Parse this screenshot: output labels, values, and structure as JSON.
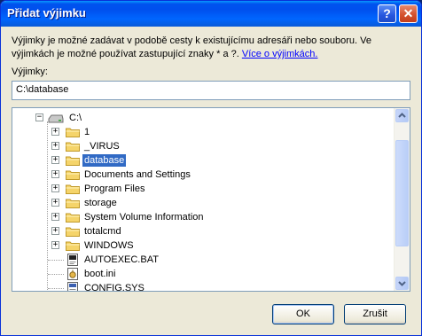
{
  "dialog": {
    "title": "Přidat výjimku",
    "help_label": "?",
    "close_label": "✕",
    "description": "Výjimky je možné zadávat v podobě cesty k existujícímu adresáři nebo souboru. Ve výjimkách je možné používat zastupující znaky * a ?.",
    "link_text": "Více o výjimkách.",
    "field_label": "Výjimky:",
    "field_value": "C:\\database",
    "ok_label": "OK",
    "cancel_label": "Zrušit"
  },
  "tree": {
    "root": {
      "label": "C:\\",
      "expander": "−"
    },
    "folders": [
      {
        "label": "1",
        "expander": "+"
      },
      {
        "label": "_VIRUS",
        "expander": "+"
      },
      {
        "label": "database",
        "expander": "+",
        "selected": true
      },
      {
        "label": "Documents and Settings",
        "expander": "+"
      },
      {
        "label": "Program Files",
        "expander": "+"
      },
      {
        "label": "storage",
        "expander": "+"
      },
      {
        "label": "System Volume Information",
        "expander": "+"
      },
      {
        "label": "totalcmd",
        "expander": "+"
      },
      {
        "label": "WINDOWS",
        "expander": "+"
      }
    ],
    "files": [
      {
        "label": "AUTOEXEC.BAT",
        "icon": "batch-file-icon"
      },
      {
        "label": "boot.ini",
        "icon": "ini-file-icon"
      },
      {
        "label": "CONFIG.SYS",
        "icon": "system-file-icon"
      }
    ]
  },
  "colors": {
    "selection": "#316ac5",
    "folder": "#f5d46a",
    "titlebar": "#0053ee"
  }
}
